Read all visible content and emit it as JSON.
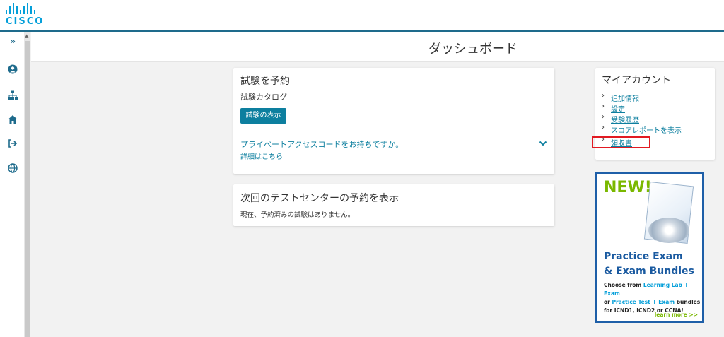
{
  "brand": {
    "logo_text": "CISCO",
    "accent": "#1e6b8c",
    "logo_color": "#049fd9"
  },
  "sidebar": {
    "items": [
      {
        "name": "expand",
        "icon": "double-chevron-right-icon",
        "glyph": "»"
      },
      {
        "name": "profile",
        "icon": "user-circle-icon",
        "glyph": "●"
      },
      {
        "name": "sitemap",
        "icon": "sitemap-icon",
        "glyph": "品"
      },
      {
        "name": "home",
        "icon": "home-icon",
        "glyph": "⌂"
      },
      {
        "name": "logout",
        "icon": "logout-icon",
        "glyph": "⇥"
      },
      {
        "name": "language",
        "icon": "globe-icon",
        "glyph": "⊕"
      }
    ]
  },
  "header": {
    "title": "ダッシュボード"
  },
  "schedule_card": {
    "title": "試験を予約",
    "catalog_label": "試験カタログ",
    "view_button": "試験の表示",
    "private_code_question": "プライベートアクセスコードをお持ちですか。",
    "details_link": "詳細はこちら"
  },
  "upcoming_card": {
    "title": "次回のテストセンターの予約を表示",
    "empty_message": "現在、予約済みの試験はありません。"
  },
  "account_card": {
    "title": "マイアカウント",
    "links": [
      "追加情報",
      "設定",
      "受験履歴",
      "スコアレポートを表示",
      "領収書"
    ],
    "highlight_color": "#e21a22"
  },
  "ad": {
    "badge": "NEW!",
    "headline_1": "Practice Exam",
    "headline_2": "& Exam Bundles",
    "body_1": "Choose from ",
    "body_hl_1": "Learning Lab + Exam",
    "body_2": "or ",
    "body_hl_2": "Practice Test + Exam",
    "body_3": " bundles",
    "body_4": "for ICND1, ICND2 or CCNA!",
    "cta": "learn more >>"
  }
}
